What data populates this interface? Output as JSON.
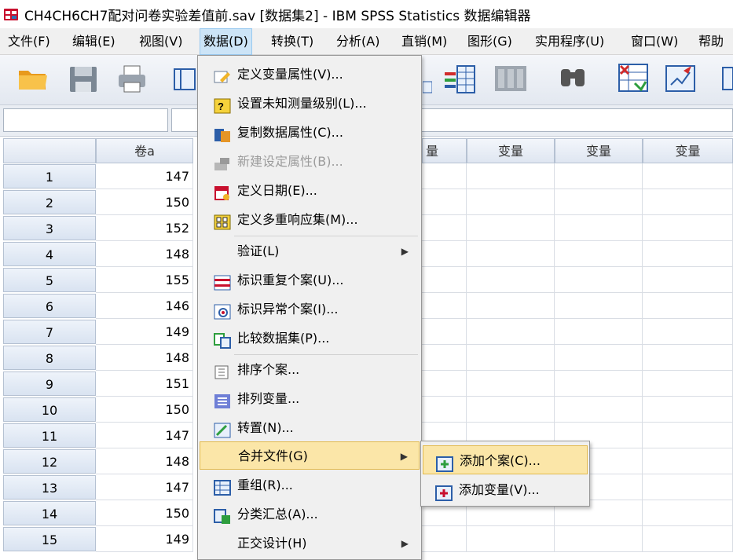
{
  "window": {
    "title": "CH4CH6CH7配对问卷实验差值前.sav [数据集2] - IBM SPSS Statistics 数据编辑器"
  },
  "menubar": [
    {
      "label": "文件(F)"
    },
    {
      "label": "编辑(E)"
    },
    {
      "label": "视图(V)"
    },
    {
      "label": "数据(D)",
      "active": true
    },
    {
      "label": "转换(T)"
    },
    {
      "label": "分析(A)"
    },
    {
      "label": "直销(M)"
    },
    {
      "label": "图形(G)"
    },
    {
      "label": "实用程序(U)"
    },
    {
      "label": "窗口(W)"
    },
    {
      "label": "帮助"
    }
  ],
  "toolbar": {
    "icons": [
      "open-folder-icon",
      "save-icon",
      "print-icon",
      "dialog-recall-icon",
      "variables-icon",
      "chart-icon",
      "find-icon",
      "insert-cases-icon",
      "select-cases-icon",
      "value-labels-icon"
    ]
  },
  "grid": {
    "columns": [
      "卷a",
      "量",
      "变量",
      "变量",
      "变量"
    ],
    "rows": [
      {
        "num": "1",
        "value": "147"
      },
      {
        "num": "2",
        "value": "150"
      },
      {
        "num": "3",
        "value": "152"
      },
      {
        "num": "4",
        "value": "148"
      },
      {
        "num": "5",
        "value": "155"
      },
      {
        "num": "6",
        "value": "146"
      },
      {
        "num": "7",
        "value": "149"
      },
      {
        "num": "8",
        "value": "148"
      },
      {
        "num": "9",
        "value": "151"
      },
      {
        "num": "10",
        "value": "150"
      },
      {
        "num": "11",
        "value": "147"
      },
      {
        "num": "12",
        "value": "148"
      },
      {
        "num": "13",
        "value": "147"
      },
      {
        "num": "14",
        "value": "150"
      },
      {
        "num": "15",
        "value": "149"
      }
    ]
  },
  "data_menu": {
    "items": [
      {
        "label": "定义变量属性(V)...",
        "icon": "define-properties-icon"
      },
      {
        "label": "设置未知测量级别(L)...",
        "icon": "measure-level-icon"
      },
      {
        "label": "复制数据属性(C)...",
        "icon": "copy-properties-icon"
      },
      {
        "label": "新建设定属性(B)...",
        "icon": "new-attribute-icon",
        "disabled": true
      },
      {
        "label": "定义日期(E)...",
        "icon": "calendar-icon"
      },
      {
        "label": "定义多重响应集(M)...",
        "icon": "multiple-response-icon"
      },
      {
        "label": "验证(L)",
        "submenu": true
      },
      {
        "label": "标识重复个案(U)...",
        "icon": "duplicate-cases-icon"
      },
      {
        "label": "标识异常个案(I)...",
        "icon": "unusual-cases-icon"
      },
      {
        "label": "比较数据集(P)...",
        "icon": "compare-datasets-icon"
      },
      {
        "label": "排序个案...",
        "icon": "sort-cases-icon"
      },
      {
        "label": "排列变量...",
        "icon": "sort-variables-icon"
      },
      {
        "label": "转置(N)...",
        "icon": "transpose-icon"
      },
      {
        "label": "合并文件(G)",
        "submenu": true,
        "hover": true
      },
      {
        "label": "重组(R)...",
        "icon": "restructure-icon"
      },
      {
        "label": "分类汇总(A)...",
        "icon": "aggregate-icon"
      },
      {
        "label": "正交设计(H)",
        "submenu": true
      }
    ]
  },
  "merge_submenu": {
    "items": [
      {
        "label": "添加个案(C)...",
        "icon": "add-cases-icon",
        "hover": true
      },
      {
        "label": "添加变量(V)...",
        "icon": "add-variables-icon"
      }
    ]
  }
}
